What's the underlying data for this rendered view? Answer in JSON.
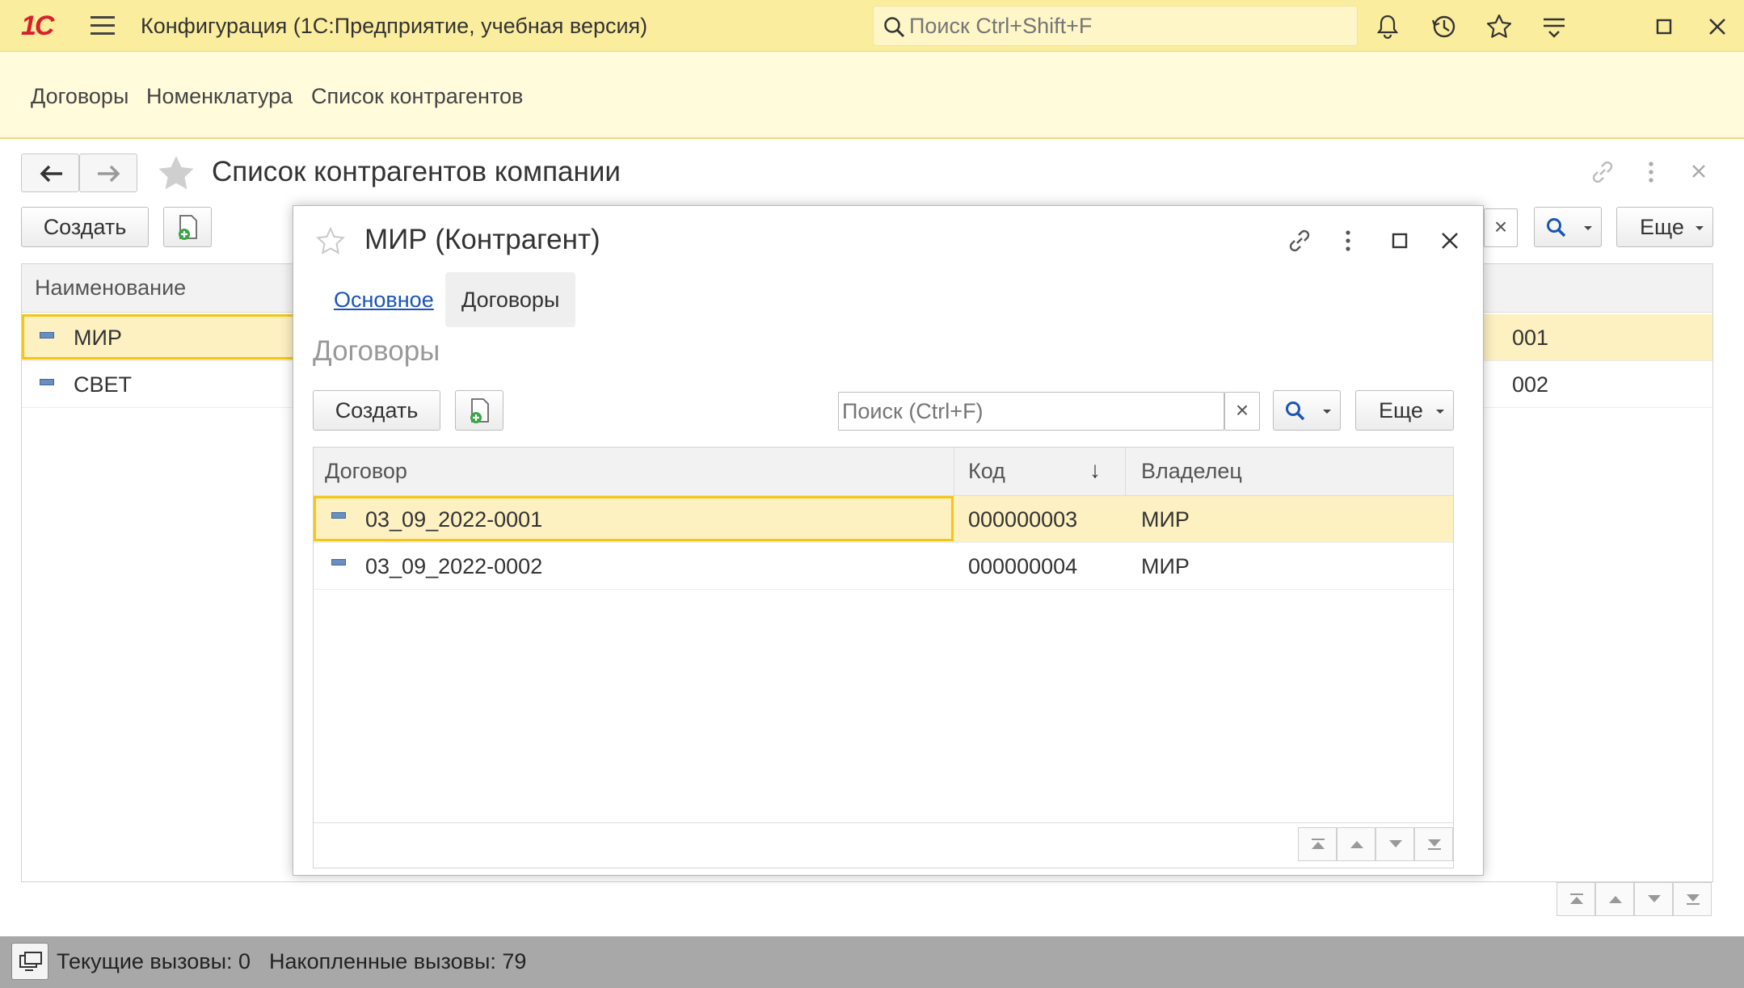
{
  "app": {
    "logo": "1С",
    "title": "Конфигурация  (1С:Предприятие, учебная версия)",
    "search_placeholder": "Поиск Ctrl+Shift+F"
  },
  "sections": [
    "Договоры",
    "Номенклатура",
    "Список контрагентов"
  ],
  "main_form": {
    "title": "Список контрагентов компании",
    "create_label": "Создать",
    "more_label": "Еще",
    "clear_symbol": "×",
    "column_name": "Наименование",
    "rows": [
      {
        "name": "МИР",
        "code_tail": "001",
        "selected": true
      },
      {
        "name": "СВЕТ",
        "code_tail": "002",
        "selected": false
      }
    ]
  },
  "modal": {
    "title": "МИР (Контрагент)",
    "tabs": [
      "Основное",
      "Договоры"
    ],
    "active_tab": "Договоры",
    "group_title": "Договоры",
    "create_label": "Создать",
    "search_placeholder": "Поиск (Ctrl+F)",
    "clear_symbol": "×",
    "more_label": "Еще",
    "columns": {
      "contract": "Договор",
      "code": "Код",
      "sort_indicator": "↓",
      "owner": "Владелец"
    },
    "rows": [
      {
        "contract": "03_09_2022-0001",
        "code": "000000003",
        "owner": "МИР",
        "selected": true
      },
      {
        "contract": "03_09_2022-0002",
        "code": "000000004",
        "owner": "МИР",
        "selected": false
      }
    ]
  },
  "status_bar": {
    "current_calls": "Текущие вызовы: 0",
    "accumulated_calls": "Накопленные вызовы: 79"
  },
  "colors": {
    "topbar": "#fbed9e",
    "section_panel": "#fffbdb",
    "selection_row": "#fdf0c1",
    "selection_border": "#f5c518",
    "link_blue": "#1a55b5",
    "logo_red": "#d8202a",
    "status_bar": "#a8a8a8"
  },
  "icons": [
    "menu-icon",
    "search-icon",
    "bell-icon",
    "history-icon",
    "star-icon",
    "panel-settings-icon",
    "maximize-icon",
    "close-icon",
    "back-arrow-icon",
    "forward-arrow-icon",
    "link-icon",
    "more-vertical-icon",
    "add-copy-icon",
    "row-marker-icon",
    "pager-first-icon",
    "pager-up-icon",
    "pager-down-icon",
    "pager-last-icon",
    "monitor-icon"
  ]
}
